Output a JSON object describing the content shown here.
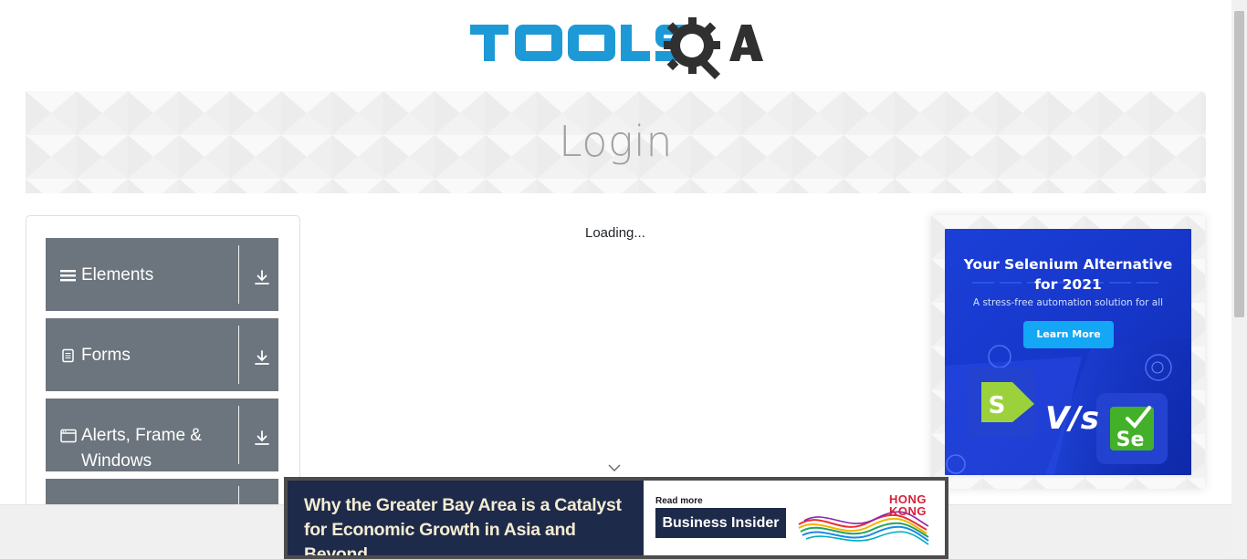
{
  "header": {
    "logo_text": "TOOLSQA"
  },
  "banner": {
    "title": "Login"
  },
  "sidebar": {
    "groups": [
      {
        "label": "Elements",
        "icon": "menu-lines-icon"
      },
      {
        "label": "Forms",
        "icon": "document-icon"
      },
      {
        "label": "Alerts, Frame & Windows",
        "icon": "window-icon"
      },
      {
        "label": "",
        "icon": ""
      }
    ]
  },
  "main": {
    "loading_text": "Loading..."
  },
  "side_ad": {
    "heading_line1": "Your Selenium Alternative",
    "heading_line2": "for 2021",
    "subtitle": "A stress-free automation solution for all",
    "button_label": "Learn More",
    "vs_text": "V/s",
    "left_logo_letter": "S",
    "right_logo_letters": "Se",
    "colors": {
      "background": "#1a3fd6",
      "button": "#14a7f5",
      "katalon_green": "#9bd23b",
      "selenium_green": "#43b02a"
    }
  },
  "bottom_ad": {
    "headline": "Why the Greater Bay Area is a Catalyst for Economic Growth in Asia and Beyond",
    "read_more": "Read more",
    "button_label": "Business Insider",
    "brand_line1": "HONG",
    "brand_line2": "KONG",
    "colors": {
      "navy": "#1e2a4a",
      "brand_red": "#d6213b"
    }
  }
}
